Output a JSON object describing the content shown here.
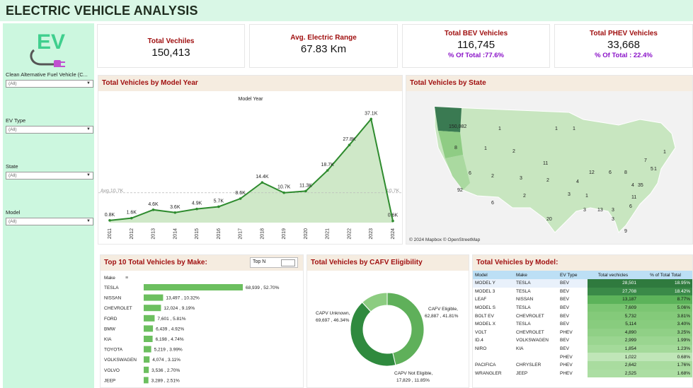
{
  "header": {
    "title": "ELECTRIC VEHICLE ANALYSIS"
  },
  "sidebar": {
    "filters": [
      {
        "label": "Clean Alternative Fuel Vehicle (C...",
        "value": "(All)"
      },
      {
        "label": "EV Type",
        "value": "(All)"
      },
      {
        "label": "State",
        "value": "(All)"
      },
      {
        "label": "Model",
        "value": "(All)"
      }
    ]
  },
  "kpis": {
    "total_vehicles": {
      "label": "Total Vechiles",
      "value": "150,413"
    },
    "avg_range": {
      "label": "Avg. Electric Range",
      "value": "67.83 Km"
    },
    "bev": {
      "label": "Total BEV Vehicles",
      "value": "116,745",
      "pct": "% Of Total :77.6%"
    },
    "phev": {
      "label": "Total PHEV Vehicles",
      "value": "33,668",
      "pct": "% Of Total : 22.4%"
    }
  },
  "model_year": {
    "title": "Total Vehicles by Model Year",
    "chart_title": "Model Year",
    "avg_label_left": "Avg.10.7K",
    "avg_label_right": "Avg.10.7K"
  },
  "state_map": {
    "title": "Total Vehicles by State",
    "attribution": "© 2024 Mapbox © OpenStreetMap",
    "labels": [
      "150,082",
      "1",
      "8",
      "1",
      "2",
      "1",
      "1",
      "6",
      "2",
      "3",
      "92",
      "6",
      "2",
      "11",
      "2",
      "4",
      "12",
      "6",
      "8",
      "7",
      "1",
      "4",
      "35",
      "11",
      "1",
      "3",
      "13",
      "3",
      "6",
      "20",
      "1",
      "3",
      "5",
      "9",
      "3"
    ]
  },
  "make_chart": {
    "title": "Top 10 Total Vehicles by Make:",
    "column_header": "Make",
    "topn_label": "Top N"
  },
  "cafv": {
    "title": "Total Vehicles by CAFV Eligibility",
    "labels": [
      {
        "line1": "CAPV Unknown,",
        "line2": "69,697 , 46.34%"
      },
      {
        "line1": "CAFV Eligible,",
        "line2": "62,887 , 41.81%"
      },
      {
        "line1": "CAPV Not Eligible,",
        "line2": "17,829 , 11.85%"
      }
    ]
  },
  "model_table": {
    "title": "Total Vehicles by Model:",
    "headers": [
      "Model",
      "Make",
      "EV Type",
      "Total vechicles",
      "% of Total Total"
    ],
    "rows": [
      [
        "MODEL Y",
        "TESLA",
        "BEV",
        "28,501",
        "18.95%"
      ],
      [
        "MODEL 3",
        "TESLA",
        "BEV",
        "27,708",
        "18.42%"
      ],
      [
        "LEAF",
        "NISSAN",
        "BEV",
        "13,187",
        "8.77%"
      ],
      [
        "MODEL S",
        "TESLA",
        "BEV",
        "7,609",
        "5.06%"
      ],
      [
        "BOLT EV",
        "CHEVROLET",
        "BEV",
        "5,732",
        "3.81%"
      ],
      [
        "MODEL X",
        "TESLA",
        "BEV",
        "5,114",
        "3.40%"
      ],
      [
        "VOLT",
        "CHEVROLET",
        "PHEV",
        "4,890",
        "3.25%"
      ],
      [
        "ID.4",
        "VOLKSWAGEN",
        "BEV",
        "2,999",
        "1.99%"
      ],
      [
        "NIRO",
        "KIA",
        "BEV",
        "1,854",
        "1.23%"
      ],
      [
        "",
        "",
        "PHEV",
        "1,022",
        "0.68%"
      ],
      [
        "PACIFICA",
        "CHRYSLER",
        "PHEV",
        "2,642",
        "1.76%"
      ],
      [
        "WRANGLER",
        "JEEP",
        "PHEV",
        "2,525",
        "1.68%"
      ]
    ]
  },
  "chart_data": [
    {
      "type": "area",
      "title": "Model Year",
      "x": [
        "2011",
        "2012",
        "2013",
        "2014",
        "2015",
        "2016",
        "2017",
        "2018",
        "2019",
        "2020",
        "2021",
        "2022",
        "2023",
        "2024"
      ],
      "values": [
        0.8,
        1.6,
        4.6,
        3.6,
        4.9,
        5.7,
        8.6,
        14.4,
        10.7,
        11.3,
        18.7,
        27.8,
        37.1,
        0.6
      ],
      "labels": [
        "0.8K",
        "1.6K",
        "4.6K",
        "3.6K",
        "4.9K",
        "5.7K",
        "8.6K",
        "14.4K",
        "10.7K",
        "11.3K",
        "18.7K",
        "27.8K",
        "37.1K",
        "0.6K"
      ],
      "reference_line": 10.7,
      "ylim": [
        0,
        40
      ],
      "color": "#2e8b2e"
    },
    {
      "type": "bar",
      "orientation": "horizontal",
      "categories": [
        "TESLA",
        "NISSAN",
        "CHEVROLET",
        "FORD",
        "BMW",
        "KIA",
        "TOYOTA",
        "VOLKSWAGEN",
        "VOLVO",
        "JEEP"
      ],
      "values": [
        68939,
        13497,
        12024,
        7601,
        6439,
        6198,
        5219,
        4074,
        3536,
        3289
      ],
      "labels": [
        "68,939 , 52.70%",
        "13,497 , 10.32%",
        "12,024 , 9.19%",
        "7,601 , 5.81%",
        "6,439 , 4.92%",
        "6,198 , 4.74%",
        "5,219 , 3.99%",
        "4,074 , 3.11%",
        "3,536 , 2.70%",
        "3,289 , 2.51%"
      ],
      "color": "#6cbf5f"
    },
    {
      "type": "pie",
      "donut": true,
      "categories": [
        "CAPV Unknown",
        "CAFV Eligible",
        "CAPV Not Eligible"
      ],
      "values": [
        69697,
        62887,
        17829
      ],
      "colors": [
        "#5fb05a",
        "#2f8a3e",
        "#8ccc80"
      ]
    }
  ],
  "colors": {
    "accent_red": "#a01010",
    "pct_purple": "#8a12c8",
    "sidebar": "#ccf7df",
    "green": "#2e8b2e"
  }
}
